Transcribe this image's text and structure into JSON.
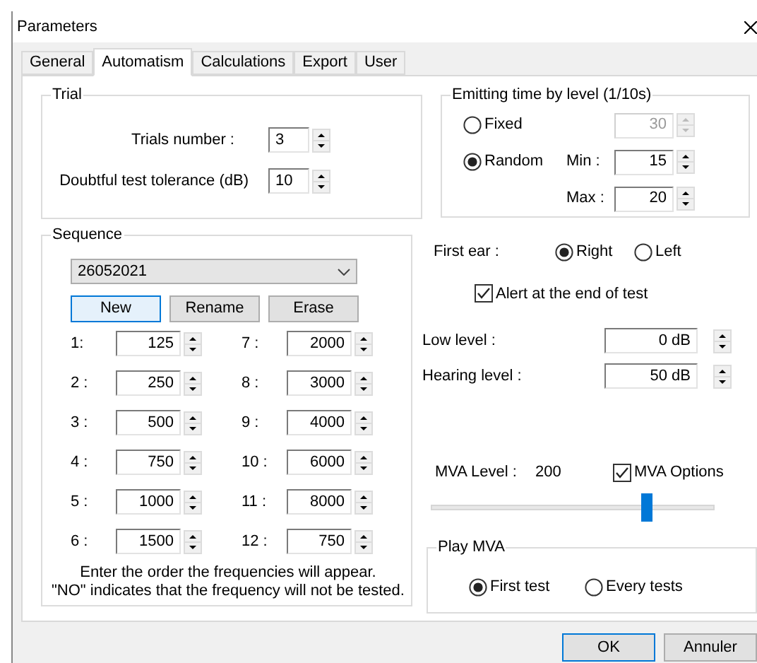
{
  "window": {
    "title": "Parameters"
  },
  "tabs": [
    {
      "label": "General",
      "selected": false
    },
    {
      "label": "Automatism",
      "selected": true
    },
    {
      "label": "Calculations",
      "selected": false
    },
    {
      "label": "Export",
      "selected": false
    },
    {
      "label": "User",
      "selected": false
    }
  ],
  "trial": {
    "title": "Trial",
    "fields": [
      {
        "label": "Trials number :",
        "value": "3"
      },
      {
        "label": "Doubtful test tolerance (dB)",
        "value": "10"
      }
    ]
  },
  "emitting_time": {
    "title": "Emitting time by level (1/10s)",
    "options": [
      {
        "label": "Fixed",
        "selected": false
      },
      {
        "label": "Random",
        "selected": true
      }
    ],
    "fixed": {
      "value": "30",
      "disabled": true
    },
    "min": {
      "label": "Min :",
      "value": "15"
    },
    "max": {
      "label": "Max :",
      "value": "20"
    }
  },
  "sequence": {
    "title": "Sequence",
    "dropdown": "26052021",
    "buttons": [
      {
        "label": "New",
        "selected": true
      },
      {
        "label": "Rename",
        "selected": false
      },
      {
        "label": "Erase",
        "selected": false
      }
    ],
    "frequencies": [
      {
        "label": "1:",
        "value": "125"
      },
      {
        "label": "2 :",
        "value": "250"
      },
      {
        "label": "3 :",
        "value": "500"
      },
      {
        "label": "4 :",
        "value": "750"
      },
      {
        "label": "5 :",
        "value": "1000"
      },
      {
        "label": "6 :",
        "value": "1500"
      },
      {
        "label": "7 :",
        "value": "2000"
      },
      {
        "label": "8 :",
        "value": "3000"
      },
      {
        "label": "9 :",
        "value": "4000"
      },
      {
        "label": "10 :",
        "value": "6000"
      },
      {
        "label": "11 :",
        "value": "8000"
      },
      {
        "label": "12 :",
        "value": "750"
      }
    ],
    "note": [
      "Enter the order the frequencies will appear.",
      "\"NO\" indicates that the frequency will not be tested."
    ]
  },
  "first_ear": {
    "label": "First ear :",
    "options": [
      {
        "label": "Right",
        "selected": true
      },
      {
        "label": "Left",
        "selected": false
      }
    ]
  },
  "alert": {
    "label": "Alert at the end of test",
    "checked": true
  },
  "levels": [
    {
      "label": "Low level :",
      "value": "0 dB"
    },
    {
      "label": "Hearing level :",
      "value": "50 dB"
    }
  ],
  "mva": {
    "label": "MVA Level :",
    "value": "200",
    "options": {
      "label": "MVA Options",
      "checked": true
    },
    "slider": {
      "level": 0.77
    }
  },
  "play_mva": {
    "title": "Play MVA",
    "options": [
      {
        "label": "First test",
        "selected": true
      },
      {
        "label": "Every tests",
        "selected": false
      }
    ]
  },
  "buttons": [
    {
      "label": "OK",
      "selected": true
    },
    {
      "label": "Annuler",
      "selected": false
    }
  ]
}
